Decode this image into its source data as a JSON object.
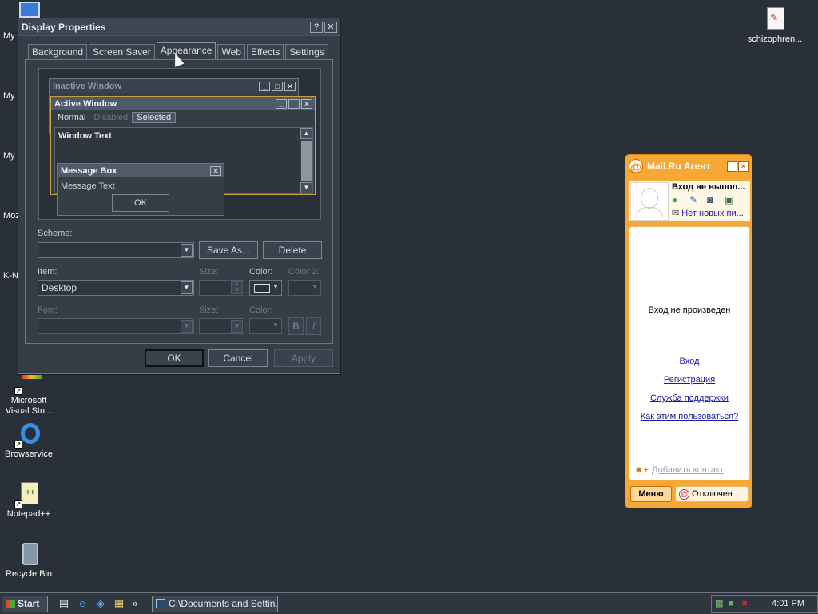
{
  "desktop": {
    "edge_labels": [
      "My",
      "My D",
      "My",
      "Moz",
      "K-N"
    ],
    "icons": [
      {
        "label": "Microsoft Visual Stu...",
        "icon": "visual-studio-icon"
      },
      {
        "label": "Browservice",
        "icon": "internet-explorer-icon"
      },
      {
        "label": "Notepad++",
        "icon": "notepad-plus-icon"
      },
      {
        "label": "Recycle Bin",
        "icon": "recycle-bin-icon"
      },
      {
        "label": "schizophren...",
        "icon": "text-file-icon"
      }
    ]
  },
  "display_properties": {
    "title": "Display Properties",
    "help_btn": "?",
    "close_btn": "✕",
    "tabs": [
      "Background",
      "Screen Saver",
      "Appearance",
      "Web",
      "Effects",
      "Settings"
    ],
    "active_tab": "Appearance",
    "preview": {
      "inactive_title": "Inactive Window",
      "active_title": "Active Window",
      "menu_normal": "Normal",
      "menu_disabled": "Disabled",
      "menu_selected": "Selected",
      "window_text": "Window Text",
      "msgbox_title": "Message Box",
      "msgbox_text": "Message Text",
      "msgbox_ok": "OK"
    },
    "scheme_label": "Scheme:",
    "scheme_value": "",
    "save_as": "Save As...",
    "delete": "Delete",
    "item_label": "Item:",
    "item_value": "Desktop",
    "size_label": "Size:",
    "color_label": "Color:",
    "color2_label": "Color 2:",
    "font_label": "Font:",
    "font_size_label": "Size:",
    "font_color_label": "Color:",
    "bold": "B",
    "italic": "I",
    "ok": "OK",
    "cancel": "Cancel",
    "apply": "Apply"
  },
  "agent": {
    "title": "Mail.Ru Агент",
    "status": "Вход не выпол...",
    "no_mail": "Нет новых пи...",
    "not_logged": "Вход не произведен",
    "links": [
      "Вход",
      "Регистрация",
      "Служба поддержки",
      "Как этим пользоваться?"
    ],
    "add_contact": "Добавить контакт",
    "menu": "Меню",
    "offline": "Отключен"
  },
  "taskbar": {
    "start": "Start",
    "task": "C:\\Documents and Settin...",
    "time": "4:01 PM"
  },
  "colors": {
    "desktop_bg": "#2a3038",
    "agent_orange": "#f7a733",
    "active_border": "#c8a13c"
  }
}
